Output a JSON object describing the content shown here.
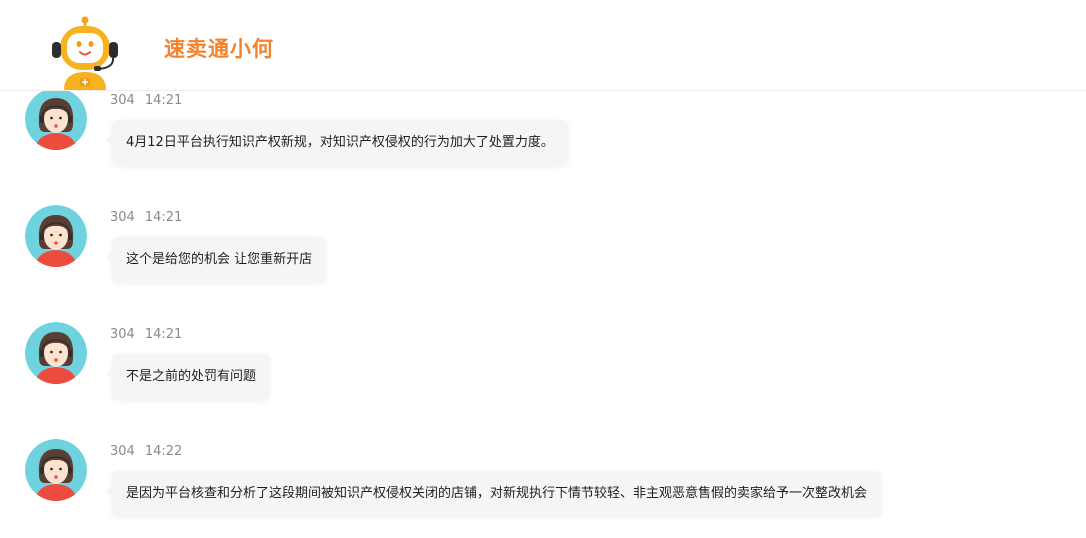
{
  "header": {
    "title": "速卖通小何",
    "logo_icon": "robot-headset-icon",
    "brand_color": "#f3822a"
  },
  "messages": [
    {
      "sender": "304",
      "time": "14:21",
      "text": "4月12日平台执行知识产权新规，对知识产权侵权的行为加大了处置力度。",
      "avatar_icon": "agent-avatar-icon"
    },
    {
      "sender": "304",
      "time": "14:21",
      "text": "这个是给您的机会 让您重新开店",
      "avatar_icon": "agent-avatar-icon"
    },
    {
      "sender": "304",
      "time": "14:21",
      "text": "不是之前的处罚有问题",
      "avatar_icon": "agent-avatar-icon"
    },
    {
      "sender": "304",
      "time": "14:22",
      "text": "是因为平台核查和分析了这段期间被知识产权侵权关闭的店铺，对新规执行下情节较轻、非主观恶意售假的卖家给予一次整改机会",
      "avatar_icon": "agent-avatar-icon"
    }
  ]
}
